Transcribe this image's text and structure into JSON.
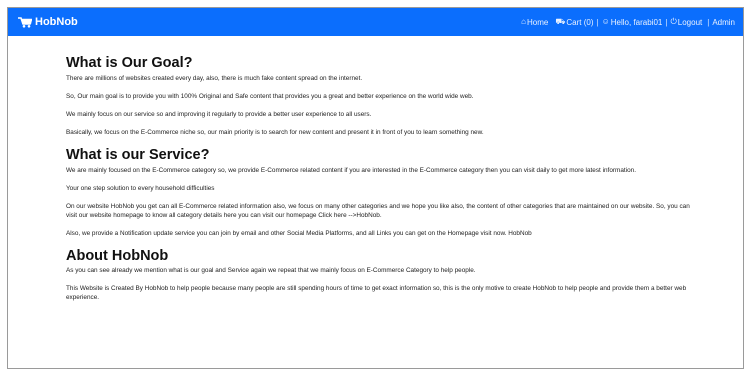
{
  "navbar": {
    "brand": "HobNob",
    "links": [
      {
        "icon": "home-icon",
        "label": "Home"
      },
      {
        "icon": "cart-icon",
        "label": "Cart (0)"
      },
      {
        "icon": "user-icon",
        "label": "Hello, farabi01"
      },
      {
        "icon": "logout-icon",
        "label": "Logout"
      },
      {
        "icon": "",
        "label": "Admin"
      }
    ],
    "separator": "|",
    "color": "#0b6efd"
  },
  "sections": [
    {
      "title": "What is Our Goal?",
      "paragraphs": [
        "There are millions of websites created every day, also, there is much fake content spread on the internet.",
        "So, Our main goal is to provide you with 100% Original and Safe content that provides you a great and better experience on the world wide web.",
        "We mainly focus on our service so and improving it regularly to provide a better user experience to all users.",
        "Basically, we focus on the E-Commerce niche so, our main priority is to search for new content and present it in front of you to learn something new."
      ]
    },
    {
      "title": "What is our Service?",
      "paragraphs": [
        "We are mainly focused on the E-Commerce category so, we provide E-Commerce related content if you are interested in the E-Commerce category then you can visit daily to get more latest information.",
        "Your one step solution to every household difficulties",
        "On our website HobNob you get can all E-Commerce related information also, we focus on many other categories and we hope you like also, the content of other categories that are maintained on our website. So, you can visit our website homepage to know all category details here you can visit our homepage Click here -->HobNob.",
        "Also, we provide a Notification update service you can join by email and other Social Media Platforms, and all Links you can get on the Homepage visit now. HobNob"
      ]
    },
    {
      "title": "About HobNob",
      "paragraphs": [
        "As you can see already we mention what is our goal and Service again we repeat that we mainly focus on E-Commerce Category to help people.",
        "This Website is Created By HobNob to help people because many people are still spending hours of time to get exact information so, this is the only motive to create HobNob to help people and provide them a better web experience."
      ]
    }
  ]
}
